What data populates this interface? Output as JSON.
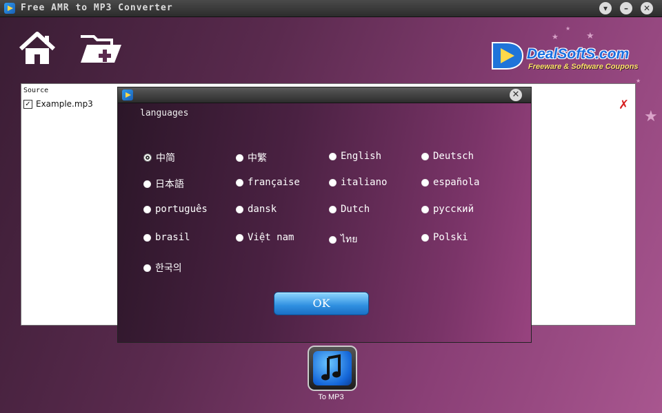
{
  "window": {
    "title": "Free AMR to MP3 Converter",
    "controls": [
      "options-icon",
      "minimize-icon",
      "close-icon"
    ]
  },
  "toolbar": {
    "items": [
      {
        "name": "home-button",
        "icon": "home-icon"
      },
      {
        "name": "add-folder-button",
        "icon": "folder-add-icon"
      }
    ]
  },
  "brand": {
    "name": "DealSoftS.com",
    "tagline": "Freeware & Software Coupons"
  },
  "source": {
    "header": "Source",
    "files": [
      {
        "name": "Example.mp3",
        "checked": true
      }
    ]
  },
  "dialog": {
    "heading": "languages",
    "languages": [
      {
        "label": "中简",
        "selected": true
      },
      {
        "label": "中繁",
        "selected": false
      },
      {
        "label": "English",
        "selected": false
      },
      {
        "label": "Deutsch",
        "selected": false
      },
      {
        "label": "日本語",
        "selected": false
      },
      {
        "label": "française",
        "selected": false
      },
      {
        "label": "italiano",
        "selected": false
      },
      {
        "label": "española",
        "selected": false
      },
      {
        "label": "português",
        "selected": false
      },
      {
        "label": "dansk",
        "selected": false
      },
      {
        "label": "Dutch",
        "selected": false
      },
      {
        "label": "русский",
        "selected": false
      },
      {
        "label": "brasil",
        "selected": false
      },
      {
        "label": "Việt nam",
        "selected": false
      },
      {
        "label": "ไทย",
        "selected": false
      },
      {
        "label": "Polski",
        "selected": false
      },
      {
        "label": "한국의",
        "selected": false
      }
    ],
    "ok_label": "OK"
  },
  "convert": {
    "label": "To MP3",
    "icon": "music-note-icon"
  },
  "colors": {
    "accent_blue": "#2f8fe0",
    "background_purple": "#8a3f76",
    "delete_red": "#d71f1f"
  }
}
